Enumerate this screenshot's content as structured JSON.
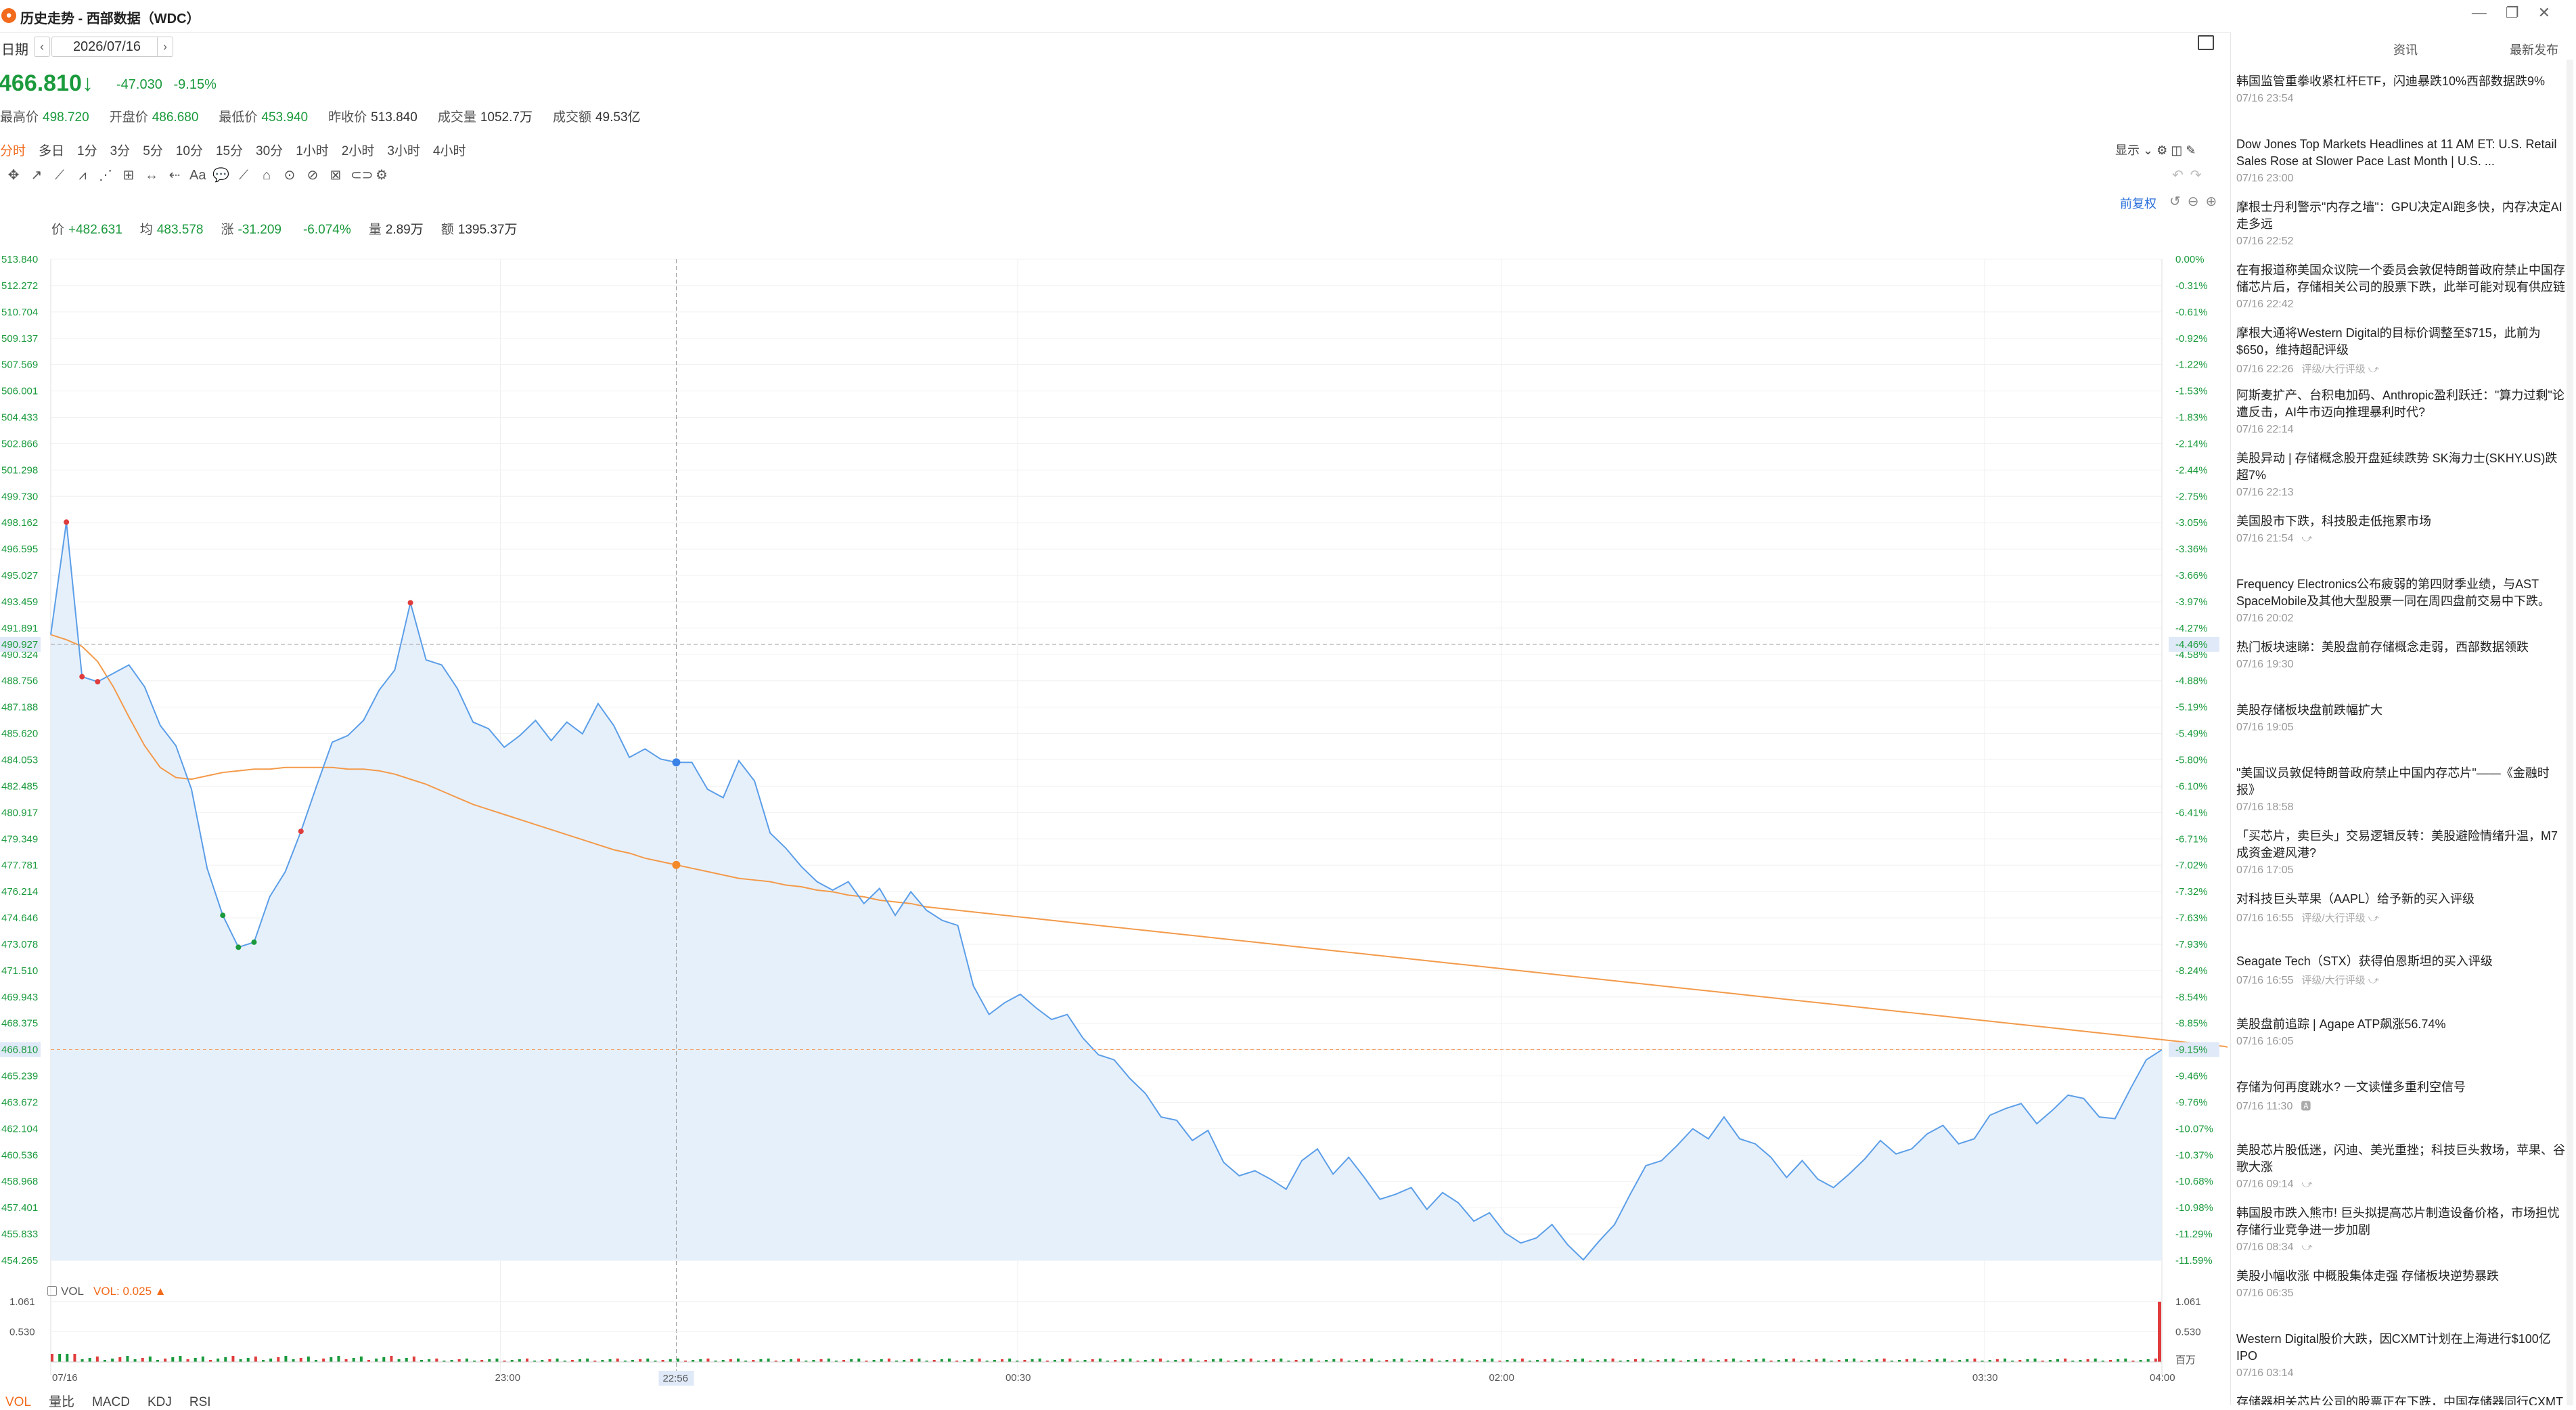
{
  "window": {
    "title": "历史走势 - 西部数据（WDC）",
    "logo_glyph": "●",
    "controls": [
      "—",
      "❐",
      "✕"
    ]
  },
  "date_bar": {
    "label": "日期",
    "value": "2026/07/16",
    "prev": "‹",
    "next": "›"
  },
  "quote": {
    "price": "466.810",
    "arrow": "↓",
    "change": "-47.030",
    "change_pct": "-9.15%",
    "stats": [
      {
        "label": "最高价",
        "value": "498.720",
        "tone": "green"
      },
      {
        "label": "开盘价",
        "value": "486.680",
        "tone": "green"
      },
      {
        "label": "最低价",
        "value": "453.940",
        "tone": "green"
      },
      {
        "label": "昨收价",
        "value": "513.840",
        "tone": "plain"
      },
      {
        "label": "成交量",
        "value": "1052.7万",
        "tone": "plain"
      },
      {
        "label": "成交额",
        "value": "49.53亿",
        "tone": "plain"
      }
    ]
  },
  "periods": [
    "分时",
    "多日",
    "1分",
    "3分",
    "5分",
    "10分",
    "15分",
    "30分",
    "1小时",
    "2小时",
    "3小时",
    "4小时"
  ],
  "active_period": "分时",
  "display_ctrl": "显示 ⌄",
  "draw_tools": [
    "✥",
    "↗",
    "⟋",
    "⩘",
    "⋰",
    "⊞",
    "↔",
    "⇠",
    "Aa",
    "💬",
    "⟋",
    "⌂",
    "⊙",
    "⊘",
    "⊠",
    "⊂⊃",
    "⚙"
  ],
  "adjust_label": "前复权",
  "infobar": [
    {
      "label": "价",
      "value": "+482.631",
      "tone": "green"
    },
    {
      "label": "均",
      "value": "483.578",
      "tone": "green"
    },
    {
      "label": "涨",
      "value": "-31.209",
      "tone": "green"
    },
    {
      "label": "",
      "value": "-6.074%",
      "tone": "green"
    },
    {
      "label": "量",
      "value": "2.89万",
      "tone": "plain"
    },
    {
      "label": "额",
      "value": "1395.37万",
      "tone": "plain"
    }
  ],
  "volume": {
    "label": "VOL",
    "value_label": "VOL: 0.025 ▲",
    "ticks": [
      "1.061",
      "0.530"
    ],
    "unit": "百万"
  },
  "bottom_tabs": [
    "VOL",
    "量比",
    "MACD",
    "KDJ",
    "RSI"
  ],
  "colors": {
    "up": "#e03c3c",
    "down": "#1a9a3c",
    "accent": "#f26a1b",
    "price_line": "#5b9ee8",
    "avg_line": "#f39a4a"
  },
  "chart_data": {
    "type": "line",
    "title": "",
    "prev_close": 513.84,
    "ylim": [
      454.265,
      513.84
    ],
    "y_ticks": [
      "513.840",
      "512.272",
      "510.704",
      "509.137",
      "507.569",
      "506.001",
      "504.433",
      "502.866",
      "501.298",
      "499.730",
      "498.162",
      "496.595",
      "495.027",
      "493.459",
      "491.891",
      "490.324",
      "488.756",
      "487.188",
      "485.620",
      "484.053",
      "482.485",
      "480.917",
      "479.349",
      "477.781",
      "476.214",
      "474.646",
      "473.078",
      "471.510",
      "469.943",
      "468.375",
      "466.807",
      "465.239",
      "463.672",
      "462.104",
      "460.536",
      "458.968",
      "457.401",
      "455.833",
      "454.265"
    ],
    "pct_ticks": [
      "0.00%",
      "-0.31%",
      "-0.61%",
      "-0.92%",
      "-1.22%",
      "-1.53%",
      "-1.83%",
      "-2.14%",
      "-2.44%",
      "-2.75%",
      "-3.05%",
      "-3.36%",
      "-3.66%",
      "-3.97%",
      "-4.27%",
      "-4.58%",
      "-4.88%",
      "-5.19%",
      "-5.49%",
      "-5.80%",
      "-6.10%",
      "-6.41%",
      "-6.71%",
      "-7.02%",
      "-7.32%",
      "-7.63%",
      "-7.93%",
      "-8.24%",
      "-8.54%",
      "-8.85%",
      "-9.15%",
      "-9.46%",
      "-9.76%",
      "-10.07%",
      "-10.37%",
      "-10.68%",
      "-10.98%",
      "-11.29%",
      "-11.59%"
    ],
    "x_ticks": [
      "07/16",
      "23:00",
      "00:30",
      "02:00",
      "03:30",
      "04:00"
    ],
    "crosshair": {
      "time": "22:56",
      "price": "490.927",
      "pct": "-4.46%"
    },
    "current": {
      "price": "466.810",
      "pct": "-9.15%"
    },
    "series": [
      {
        "values": [
          491.5,
          498.2,
          489,
          488.7,
          489.2,
          489.7,
          488.4,
          486.1,
          484.9,
          482.3,
          477.6,
          474.8,
          472.9,
          473.2,
          475.9,
          477.4,
          479.8,
          482.5,
          485.1,
          485.5,
          486.4,
          488.2,
          489.4,
          493.4,
          490,
          489.7,
          488.3,
          486.3,
          485.9,
          484.8,
          485.5,
          486.4,
          485.2,
          486.3,
          485.6,
          487.4,
          486.1,
          484.2,
          484.7,
          484.1,
          483.9,
          483.9,
          482.3,
          481.8,
          484,
          482.8,
          479.7,
          478.8,
          477.7,
          476.8,
          476.3,
          476.8,
          475.5,
          476.4,
          474.8,
          476.2,
          475.1,
          474.5,
          474.2,
          470.6,
          468.9,
          469.6,
          470.1,
          469.3,
          468.6,
          468.9,
          467.5,
          466.5,
          466.2,
          465.1,
          464.2,
          462.8,
          462.6,
          461.4,
          462,
          460.1,
          459.3,
          459.6,
          459.1,
          458.5,
          460.2,
          460.9,
          459.4,
          460.4,
          459.2,
          457.9,
          458.2,
          458.6,
          457.3,
          458.3,
          457.7,
          456.6,
          457.1,
          455.9,
          455.3,
          455.6,
          456.4,
          455.2,
          454.3,
          455.4,
          456.4,
          458.2,
          459.9,
          460.2,
          461.1,
          462.1,
          461.5,
          462.8,
          461.5,
          461.2,
          460.4,
          459.2,
          460.2,
          459.1,
          458.6,
          459.4,
          460.3,
          461.4,
          460.6,
          460.9,
          461.8,
          462.3,
          461.2,
          461.5,
          462.9,
          463.3,
          463.6,
          462.4,
          463.2,
          464.1,
          463.9,
          462.8,
          462.7,
          464.5,
          466.2,
          466.8
        ],
        "avg": [
          491.5,
          491.2,
          490.8,
          489.9,
          488.4,
          486.6,
          484.9,
          483.6,
          483,
          482.9,
          483.1,
          483.3,
          483.4,
          483.5,
          483.5,
          483.6,
          483.6,
          483.6,
          483.6,
          483.5,
          483.5,
          483.4,
          483.2,
          482.9,
          482.6,
          482.2,
          481.8,
          481.4,
          481.1,
          480.8,
          480.5,
          480.2,
          479.9,
          479.6,
          479.3,
          479,
          478.7,
          478.5,
          478.2,
          478,
          477.8,
          477.6,
          477.4,
          477.2,
          477,
          476.9,
          476.8,
          476.6,
          476.5,
          476.3,
          476.2,
          476,
          475.9,
          475.7,
          475.6,
          475.5,
          475.3,
          475.2,
          475.1,
          475,
          474.9,
          474.8,
          474.7,
          474.6,
          474.5,
          474.4,
          474.3,
          474.2,
          474.1,
          474,
          473.9,
          473.8,
          473.7,
          473.6,
          473.5,
          473.4,
          473.3,
          473.2,
          473.1,
          473,
          472.9,
          472.8,
          472.7,
          472.6,
          472.5,
          472.4,
          472.3,
          472.2,
          472.1,
          472,
          471.9,
          471.8,
          471.7,
          471.6,
          471.5,
          471.4,
          471.3,
          471.2,
          471.1,
          471,
          470.9,
          470.8,
          470.7,
          470.6,
          470.5,
          470.4,
          470.3,
          470.2,
          470.1,
          470,
          469.9,
          469.8,
          469.7,
          469.6,
          469.5,
          469.4,
          469.3,
          469.2,
          469.1,
          469,
          468.9,
          468.8,
          468.7,
          468.6,
          468.5,
          468.4,
          468.3,
          468.2,
          468.1,
          468,
          467.9,
          467.8,
          467.7,
          467.6,
          467.5,
          467.4,
          467.3,
          467.2,
          467.1,
          467.0,
          466.8
        ]
      }
    ]
  },
  "news": {
    "tabs": [
      "资讯",
      "最新发布"
    ],
    "items": [
      {
        "title": "韩国监管重拳收紧杠杆ETF，闪迪暴跌10%西部数据跌9%",
        "time": "07/16 23:54",
        "tag": ""
      },
      {
        "title": "Dow Jones Top Markets Headlines at 11 AM ET: U.S. Retail Sales Rose at Slower Pace Last Month | U.S. ...",
        "time": "07/16 23:00",
        "tag": ""
      },
      {
        "title": "摩根士丹利警示\"内存之墙\"：GPU决定AI跑多快，内存决定AI走多远",
        "time": "07/16 22:52",
        "tag": ""
      },
      {
        "title": "在有报道称美国众议院一个委员会敦促特朗普政府禁止中国存储芯片后，存储相关公司的股票下跌，此举可能对现有供应链",
        "time": "07/16 22:42",
        "tag": ""
      },
      {
        "title": "摩根大通将Western Digital的目标价调整至$715，此前为$650，维持超配评级",
        "time": "07/16 22:26",
        "tag": "评级/大行评级 ⤻"
      },
      {
        "title": "阿斯麦扩产、台积电加码、Anthropic盈利跃迁：\"算力过剩\"论遭反击，AI牛市迈向推理暴利时代?",
        "time": "07/16 22:14",
        "tag": ""
      },
      {
        "title": "美股异动 | 存储概念股开盘延续跌势 SK海力士(SKHY.US)跌超7%",
        "time": "07/16 22:13",
        "tag": ""
      },
      {
        "title": "美国股市下跌，科技股走低拖累市场",
        "time": "07/16 21:54",
        "tag": "⤻"
      },
      {
        "title": "Frequency Electronics公布疲弱的第四财季业绩，与AST SpaceMobile及其他大型股票一同在周四盘前交易中下跌。",
        "time": "07/16 20:02",
        "tag": ""
      },
      {
        "title": "热门板块速睇：美股盘前存储概念走弱，西部数据领跌",
        "time": "07/16 19:30",
        "tag": ""
      },
      {
        "title": "美股存储板块盘前跌幅扩大",
        "time": "07/16 19:05",
        "tag": ""
      },
      {
        "title": "\"美国议员敦促特朗普政府禁止中国内存芯片\"——《金融时报》",
        "time": "07/16 18:58",
        "tag": ""
      },
      {
        "title": "「买芯片，卖巨头」交易逻辑反转：美股避险情绪升温，M7成资金避风港?",
        "time": "07/16 17:05",
        "tag": ""
      },
      {
        "title": "对科技巨头苹果（AAPL）给予新的买入评级",
        "time": "07/16 16:55",
        "tag": "评级/大行评级 ⤻"
      },
      {
        "title": "Seagate Tech（STX）获得伯恩斯坦的买入评级",
        "time": "07/16 16:55",
        "tag": "评级/大行评级 ⤻"
      },
      {
        "title": "美股盘前追踪 | Agape ATP飙涨56.74%",
        "time": "07/16 16:05",
        "tag": ""
      },
      {
        "title": "存储为何再度跳水? 一文读懂多重利空信号",
        "time": "07/16 11:30",
        "tag": "🅰"
      },
      {
        "title": "美股芯片股低迷，闪迪、美光重挫；科技巨头救场，苹果、谷歌大涨",
        "time": "07/16 09:14",
        "tag": "⤻"
      },
      {
        "title": "韩国股市跌入熊市! 巨头拟提高芯片制造设备价格，市场担忧存储行业竞争进一步加剧",
        "time": "07/16 08:34",
        "tag": "⤻"
      },
      {
        "title": "美股小幅收涨 中概股集体走强 存储板块逆势暴跌",
        "time": "07/16 06:35",
        "tag": ""
      },
      {
        "title": "Western Digital股价大跌，因CXMT计划在上海进行$100亿IPO",
        "time": "07/16 03:14",
        "tag": ""
      },
      {
        "title": "存储器相关芯片公司的股票正在下跌，中国存储器同行CXMT",
        "time": "",
        "tag": ""
      }
    ]
  }
}
